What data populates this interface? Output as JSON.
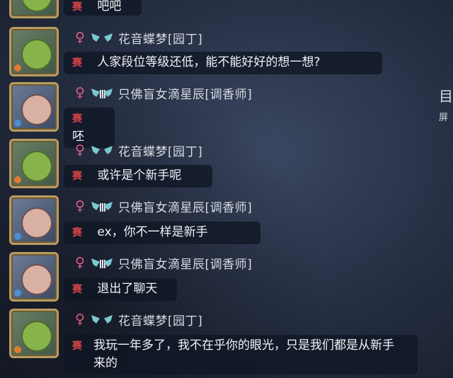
{
  "tag_label": "赛",
  "gender_symbol": "♀",
  "right_edge": {
    "glyph": "目",
    "sub": "屏"
  },
  "top_partial": {
    "text": "吧吧"
  },
  "messages": [
    {
      "avatar": "gardener",
      "name": "花音蝶梦[园丁]",
      "badge": "wing",
      "text": "人家段位等级还低，能不能好好的想一想?"
    },
    {
      "avatar": "perfumer",
      "name": "只佛盲女滴星辰[调香师]",
      "badge": "wing-bars",
      "text": "呸"
    },
    {
      "avatar": "gardener",
      "name": "花音蝶梦[园丁]",
      "badge": "wing",
      "text": "或许是个新手呢"
    },
    {
      "avatar": "perfumer",
      "name": "只佛盲女滴星辰[调香师]",
      "badge": "wing-bars",
      "text": "ex，你不一样是新手"
    },
    {
      "avatar": "perfumer",
      "name": "只佛盲女滴星辰[调香师]",
      "badge": "wing-bars",
      "text": "退出了聊天"
    },
    {
      "avatar": "gardener",
      "name": "花音蝶梦[园丁]",
      "badge": "wing",
      "text": "我玩一年多了，我不在乎你的眼光，只是我们都是从新手来的"
    }
  ]
}
